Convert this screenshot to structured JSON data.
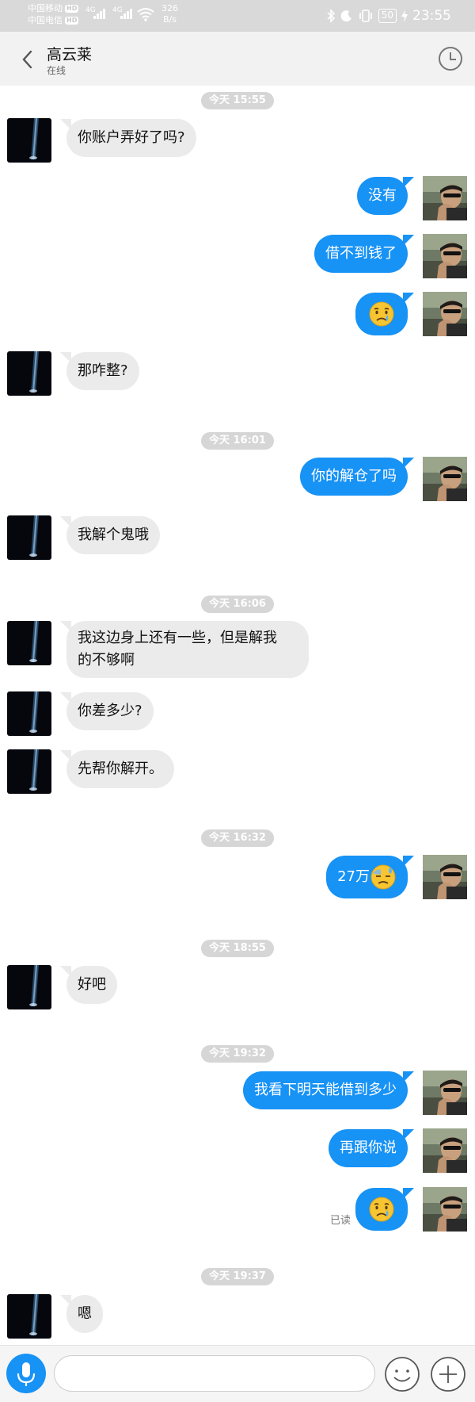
{
  "statusbar": {
    "carrier1": "中国移动",
    "carrier2": "中国电信",
    "hd": "HD",
    "net": "4G",
    "speed_value": "326",
    "speed_unit": "B/s",
    "battery": "50",
    "time": "23:55"
  },
  "header": {
    "back_icon": "chevron-left-icon",
    "title": "高云莱",
    "subtitle": "在线",
    "clock_icon": "clock-icon"
  },
  "timestamps": [
    "今天 15:55",
    "今天 16:01",
    "今天 16:06",
    "今天 16:32",
    "今天 18:55",
    "今天 19:32",
    "今天 19:37"
  ],
  "messages": [
    {
      "side": "left",
      "text": "你账户弄好了吗?"
    },
    {
      "side": "right",
      "text": "没有"
    },
    {
      "side": "right",
      "text": "借不到钱了"
    },
    {
      "side": "right",
      "emoji": "crying-face"
    },
    {
      "side": "left",
      "text": "那咋整?"
    },
    {
      "side": "right",
      "text": "你的解仓了吗"
    },
    {
      "side": "left",
      "text": "我解个鬼哦"
    },
    {
      "side": "left",
      "text": "我这边身上还有一些，但是解我的不够啊",
      "line1": "我这边身上还有一些，但是解我",
      "line2": "的不够啊"
    },
    {
      "side": "left",
      "text": "你差多少?"
    },
    {
      "side": "left",
      "text": "先帮你解开。"
    },
    {
      "side": "right",
      "text": "27万",
      "emoji": "downcast-sweat-face"
    },
    {
      "side": "left",
      "text": "好吧"
    },
    {
      "side": "right",
      "text": "我看下明天能借到多少"
    },
    {
      "side": "right",
      "text": "再跟你说"
    },
    {
      "side": "right",
      "emoji": "crying-face",
      "status": "已读"
    },
    {
      "side": "left",
      "text": "嗯"
    }
  ],
  "composer": {
    "placeholder": "",
    "mic_icon": "microphone-icon",
    "emoji_icon": "smiley-icon",
    "plus_icon": "plus-icon"
  },
  "colors": {
    "accent": "#1792f5",
    "bubble_left": "#ebebeb",
    "stamp_bg": "#d6d6d6"
  }
}
